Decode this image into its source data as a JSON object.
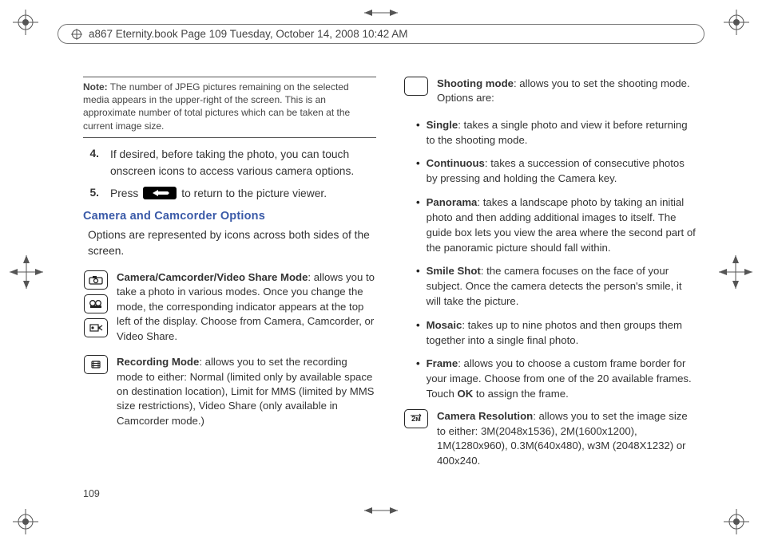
{
  "header": "a867 Eternity.book  Page 109  Tuesday, October 14, 2008  10:42 AM",
  "page_number": "109",
  "note": {
    "label": "Note:",
    "body": "The number of JPEG pictures remaining on the selected media appears in the upper-right of the screen. This is an approximate number of total pictures which can be taken at the current image size."
  },
  "step4": {
    "num": "4.",
    "text": "If desired, before taking the photo, you can touch onscreen icons to access various camera options."
  },
  "step5": {
    "num": "5.",
    "press": "Press",
    "after": "to return to the picture viewer."
  },
  "section_heading": "Camera and Camcorder Options",
  "section_intro": "Options are represented by icons across both sides of the screen.",
  "feat_mode": {
    "lead": "Camera/Camcorder/Video Share Mode",
    "body": ": allows you to take a photo in various modes. Once you change the mode, the corresponding indicator appears at the top left of the display. Choose from Camera, Camcorder, or Video Share."
  },
  "feat_rec": {
    "lead": "Recording Mode",
    "body": ": allows you to set the recording mode to either: Normal (limited only by available space on destination location), Limit for MMS (limited by MMS size restrictions), Video Share (only available in Camcorder mode.)"
  },
  "feat_shoot": {
    "lead": "Shooting mode",
    "body": ": allows you to set the shooting mode. Options are:"
  },
  "opts": {
    "single": {
      "lead": "Single",
      "body": ": takes a single photo and view it before returning to the shooting mode."
    },
    "continuous": {
      "lead": "Continuous",
      "body": ": takes a succession of consecutive photos by pressing and holding the Camera key."
    },
    "panorama": {
      "lead": "Panorama",
      "body": ": takes a landscape photo by taking an initial photo and then adding additional images to itself. The guide box lets you view the area where the second part of the panoramic picture should fall within."
    },
    "smile": {
      "lead": "Smile Shot",
      "body": ": the camera focuses on the face of your subject. Once the camera detects the person's smile, it will take the picture."
    },
    "mosaic": {
      "lead": "Mosaic",
      "body": ": takes up to nine photos and then groups them together into a single final photo."
    },
    "frame": {
      "lead": "Frame",
      "body1": ": allows you to choose a custom frame border for your image. Choose from one of the 20 available frames. Touch ",
      "ok": "OK",
      "body2": " to assign the frame."
    }
  },
  "feat_res": {
    "lead": "Camera Resolution",
    "body": ": allows you to set the image size to either: 3M(2048x1536), 2M(1600x1200), 1M(1280x960), 0.3M(640x480), w3M (2048X1232) or 400x240."
  }
}
